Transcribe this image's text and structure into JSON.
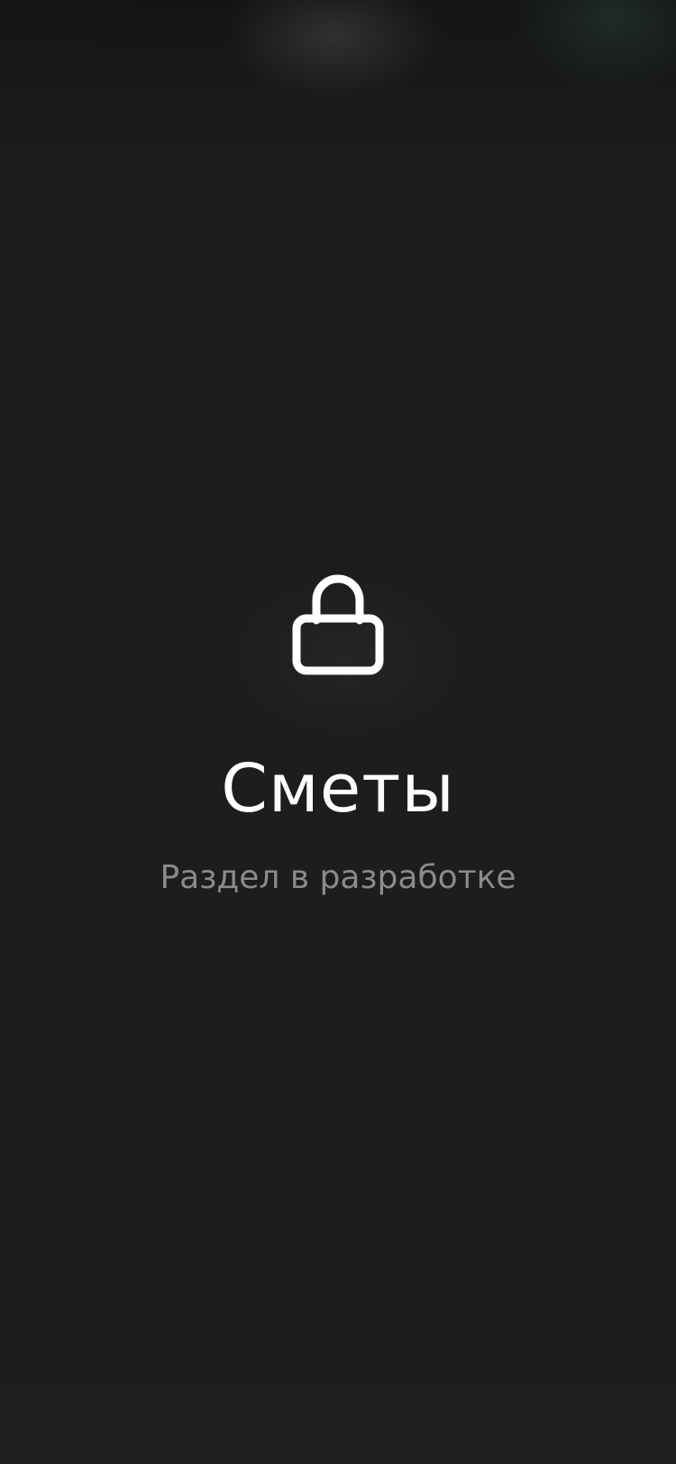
{
  "screen": {
    "icon": "lock-icon",
    "title": "Сметы",
    "subtitle": "Раздел в разработке"
  },
  "colors": {
    "background": "#1c1d1f",
    "title": "#ffffff",
    "subtitle": "#8a8b8c",
    "icon": "#ffffff"
  }
}
